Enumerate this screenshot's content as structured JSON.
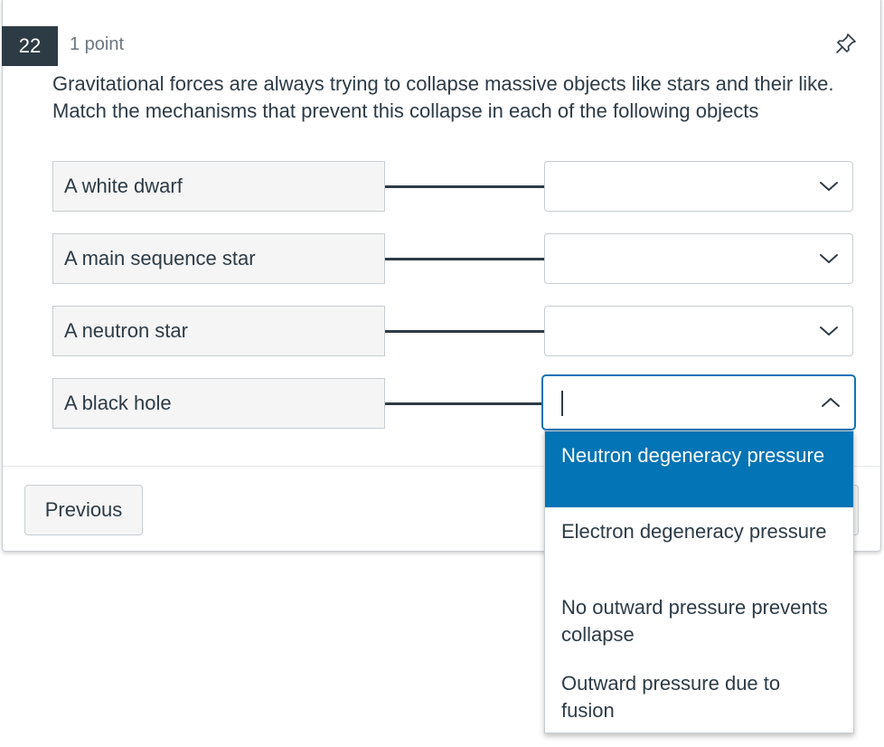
{
  "question": {
    "number": "22",
    "points": "1 point",
    "prompt": "Gravitational forces are always trying to collapse massive objects like stars and their like. Match the mechanisms that prevent this collapse in each of the following objects"
  },
  "pairs": [
    {
      "label": "A white dwarf",
      "selected": ""
    },
    {
      "label": "A main sequence star",
      "selected": ""
    },
    {
      "label": "A neutron star",
      "selected": ""
    },
    {
      "label": "A black hole",
      "selected": ""
    }
  ],
  "dropdown": {
    "options": [
      "Neutron degeneracy pressure",
      "Electron degeneracy pressure",
      "No outward pressure prevents collapse",
      "Outward pressure due to fusion"
    ],
    "highlighted_index": 0
  },
  "navigation": {
    "previous_label": "Previous"
  },
  "colors": {
    "question_badge": "#2d3b45",
    "focus_border": "#1073b6",
    "highlight": "#0374b5"
  },
  "icons": {
    "pin": "pin-icon",
    "dropdown_closed": "chevron-down-icon",
    "dropdown_open": "chevron-up-icon"
  }
}
